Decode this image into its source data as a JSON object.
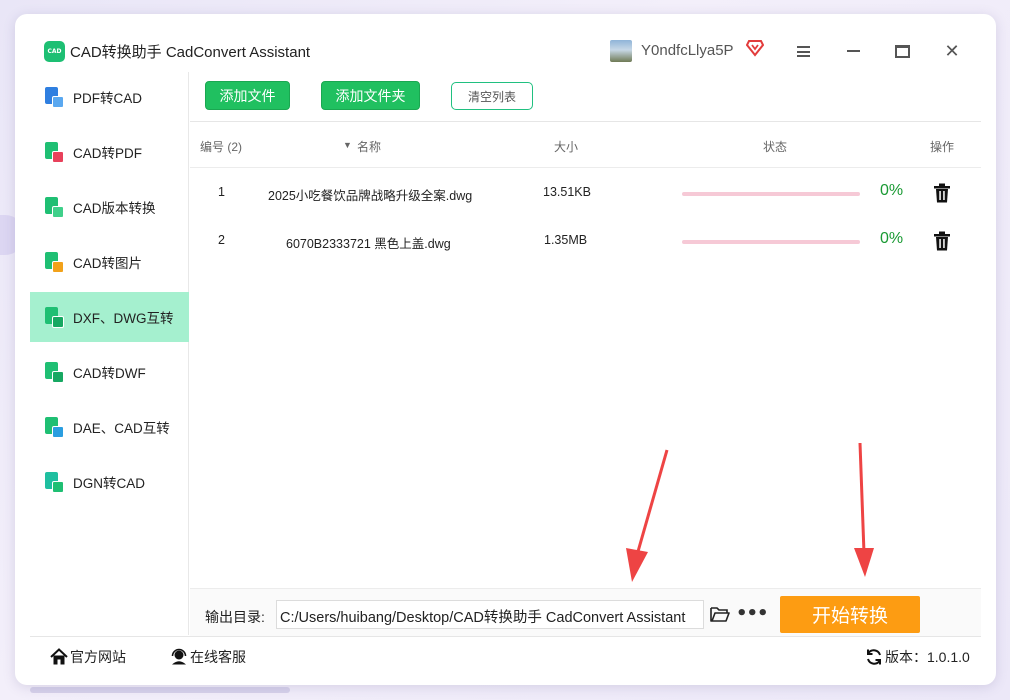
{
  "window": {
    "title": "CAD转换助手 CadConvert Assistant",
    "logo_text": "CAD",
    "username": "Y0ndfcLlya5P"
  },
  "sidebar": {
    "items": [
      {
        "label": "PDF转CAD",
        "active": false,
        "color": "#2f7fe0"
      },
      {
        "label": "CAD转PDF",
        "active": false,
        "color": "#e8415b"
      },
      {
        "label": "CAD版本转换",
        "active": false,
        "color": "#1fbf73"
      },
      {
        "label": "CAD转图片",
        "active": false,
        "color": "#f2a21a"
      },
      {
        "label": "DXF、DWG互转",
        "active": true,
        "color": "#1fbf73"
      },
      {
        "label": "CAD转DWF",
        "active": false,
        "color": "#1fbf73"
      },
      {
        "label": "DAE、CAD互转",
        "active": false,
        "color": "#2a9ee0"
      },
      {
        "label": "DGN转CAD",
        "active": false,
        "color": "#1fbfa0"
      }
    ]
  },
  "toolbar": {
    "add_file": "添加文件",
    "add_folder": "添加文件夹",
    "clear_list": "清空列表"
  },
  "table": {
    "headers": {
      "index": "编号 (2)",
      "name": "名称",
      "size": "大小",
      "status": "状态",
      "action": "操作"
    },
    "rows": [
      {
        "index": "1",
        "name": "2025小吃餐饮品牌战略升级全案.dwg",
        "size": "13.51KB",
        "progress": 0,
        "percent": "0%"
      },
      {
        "index": "2",
        "name": "6070B2333721 黑色上盖.dwg",
        "size": "1.35MB",
        "progress": 0,
        "percent": "0%"
      }
    ]
  },
  "output": {
    "label": "输出目录:",
    "path": "C:/Users/huibang/Desktop/CAD转换助手 CadConvert Assistant",
    "start_button": "开始转换"
  },
  "footer": {
    "website": "官方网站",
    "support": "在线客服",
    "version_label": "版本：1.0.1.0"
  },
  "colors": {
    "accent_green": "#20c060",
    "active_bg": "#a5f0cf",
    "start_orange": "#fd9c12",
    "annotation_red": "#ee4444"
  }
}
